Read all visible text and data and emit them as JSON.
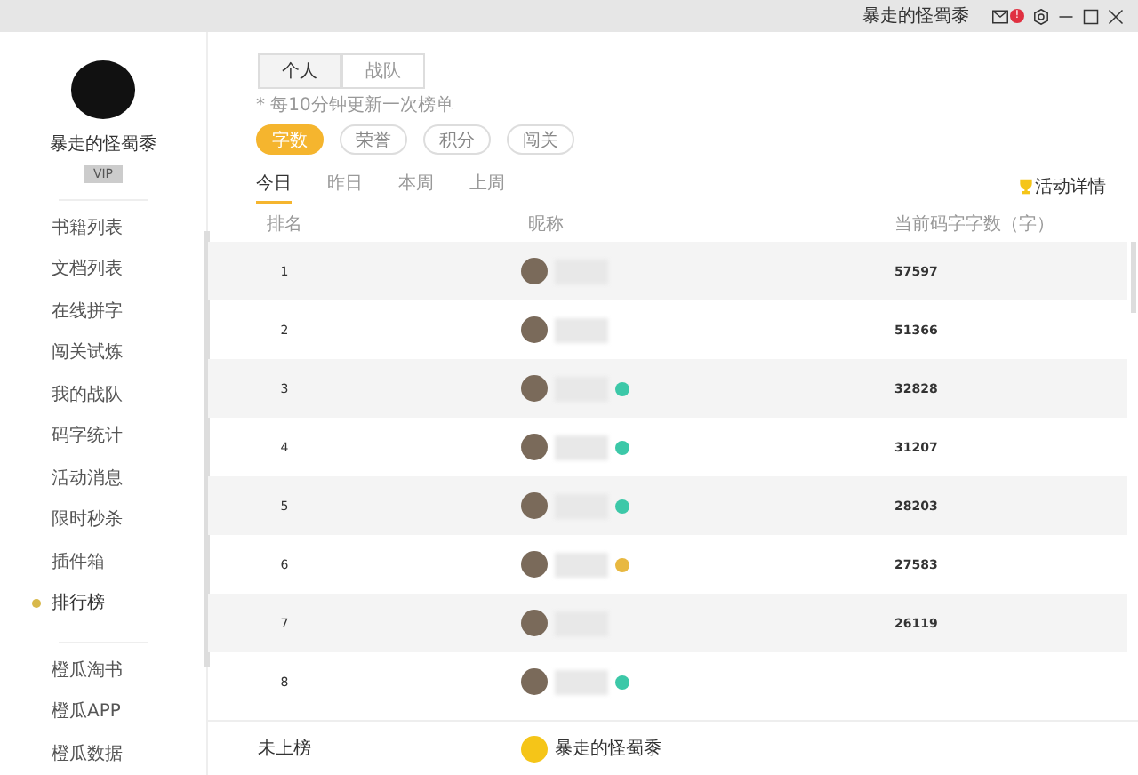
{
  "title_bar": {
    "user": "暴走的怪蜀黍",
    "mail_badge": "!"
  },
  "sidebar": {
    "user_name": "暴走的怪蜀黍",
    "vip_label": "VIP",
    "items": [
      {
        "label": "书籍列表",
        "selected": false
      },
      {
        "label": "文档列表",
        "selected": false
      },
      {
        "label": "在线拼字",
        "selected": false
      },
      {
        "label": "闯关试炼",
        "selected": false
      },
      {
        "label": "我的战队",
        "selected": false
      },
      {
        "label": "码字统计",
        "selected": false
      },
      {
        "label": "活动消息",
        "selected": false
      },
      {
        "label": "限时秒杀",
        "selected": false
      },
      {
        "label": "插件箱",
        "selected": false
      },
      {
        "label": "排行榜",
        "selected": true
      }
    ],
    "links": [
      "橙瓜淘书",
      "橙瓜APP",
      "橙瓜数据"
    ]
  },
  "scope_toggle": [
    {
      "label": "个人",
      "selected": true
    },
    {
      "label": "战队",
      "selected": false
    }
  ],
  "update_note": "* 每10分钟更新一次榜单",
  "categories": [
    {
      "label": "字数",
      "selected": true
    },
    {
      "label": "荣誉",
      "selected": false
    },
    {
      "label": "积分",
      "selected": false
    },
    {
      "label": "闯关",
      "selected": false
    }
  ],
  "periods": [
    {
      "label": "今日",
      "selected": true
    },
    {
      "label": "昨日",
      "selected": false
    },
    {
      "label": "本周",
      "selected": false
    },
    {
      "label": "上周",
      "selected": false
    }
  ],
  "activity_link": "活动详情",
  "table": {
    "columns": [
      "排名",
      "昵称",
      "当前码字字数（字）"
    ],
    "rows": [
      {
        "rank": "1",
        "words": "57597"
      },
      {
        "rank": "2",
        "words": "51366"
      },
      {
        "rank": "3",
        "words": "32828",
        "color": "#3cc8a8"
      },
      {
        "rank": "4",
        "words": "31207",
        "color": "#3cc8a8"
      },
      {
        "rank": "5",
        "words": "28203",
        "color": "#3cc8a8"
      },
      {
        "rank": "6",
        "words": "27583",
        "color": "#e8b840"
      },
      {
        "rank": "7",
        "words": "26119"
      },
      {
        "rank": "8",
        "color": "#3cc8a8"
      }
    ]
  },
  "footer": {
    "rank": "未上榜",
    "name": "暴走的怪蜀黍"
  }
}
